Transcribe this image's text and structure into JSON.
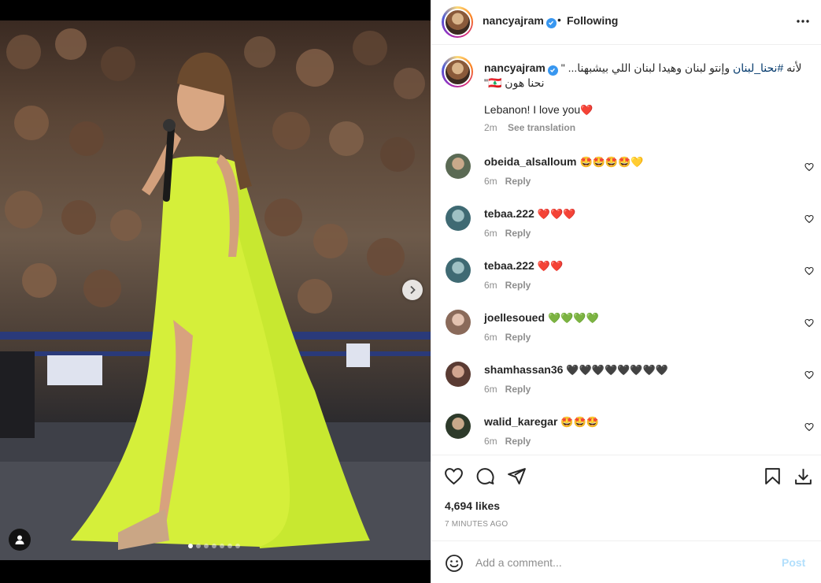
{
  "post": {
    "author": "nancyajram",
    "follow_status": "Following",
    "separator": "•",
    "caption_arabic": "لأنه #نحنا_لبنان وإنتو لبنان وهيدا لبنان اللي بيشبهنا...",
    "caption_hashtag": "#نحنا_لبنان",
    "caption_arabic_line2": "نحنا هون 🇱🇧\"",
    "caption_quote_open": "\"",
    "caption_english": "Lebanon! I love you",
    "caption_emoji": "❤️",
    "caption_time": "2m",
    "see_translation": "See translation",
    "likes": "4,694 likes",
    "posted_ago": "7 MINUTES AGO",
    "carousel_slide": 1,
    "carousel_total": 7
  },
  "comments": [
    {
      "username": "obeida_alsalloum",
      "text": "🤩🤩🤩🤩💛",
      "time": "6m",
      "reply": "Reply"
    },
    {
      "username": "tebaa.222",
      "text": "❤️❤️❤️",
      "time": "6m",
      "reply": "Reply"
    },
    {
      "username": "tebaa.222",
      "text": "❤️❤️",
      "time": "6m",
      "reply": "Reply"
    },
    {
      "username": "joellesoued",
      "text": "💚💚💚💚",
      "time": "6m",
      "reply": "Reply"
    },
    {
      "username": "shamhassan36",
      "text": "🖤🖤🖤🖤🖤🖤🖤🖤",
      "time": "6m",
      "reply": "Reply"
    },
    {
      "username": "walid_karegar",
      "text": "🤩🤩🤩",
      "time": "6m",
      "reply": "Reply"
    }
  ],
  "add_comment": {
    "placeholder": "Add a comment...",
    "post_label": "Post"
  },
  "icons": {
    "more": "more-options-icon",
    "verified": "verified-badge-icon",
    "like": "heart-icon",
    "comment": "comment-icon",
    "share": "share-icon",
    "save": "bookmark-icon",
    "download": "download-icon",
    "emoji": "emoji-icon",
    "next": "chevron-right-icon",
    "tags": "user-tag-icon"
  },
  "colors": {
    "link": "#00376b",
    "verified": "#3897f0",
    "post_disabled": "#b2dffc",
    "secondary": "#8e8e8e"
  }
}
